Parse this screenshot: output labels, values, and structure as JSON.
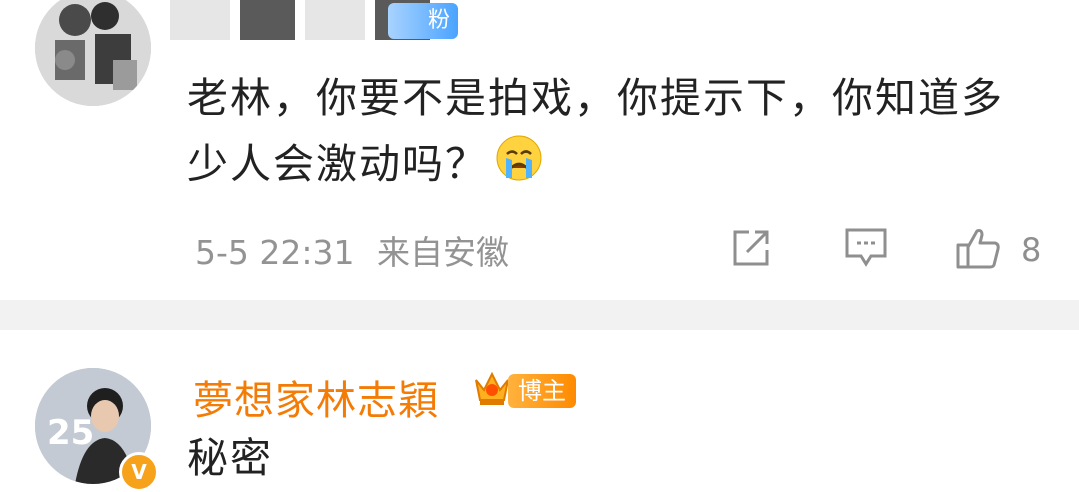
{
  "comments": [
    {
      "fan_badge": "粉",
      "text": "老林，你要不是拍戏，你提示下，你知道多少人会激动吗？",
      "time": "5-5 22:31",
      "location": "来自安徽",
      "likes": "8"
    },
    {
      "username": "夢想家林志穎",
      "badge": "博主",
      "text": "秘密",
      "avatar_number": "25",
      "verified_mark": "V"
    }
  ],
  "colors": {
    "username": "#f47c06",
    "meta": "#939393",
    "separator": "#f2f2f2"
  },
  "icons": [
    "share-icon",
    "comment-icon",
    "like-icon",
    "crying-emoji-icon",
    "crown-icon"
  ]
}
